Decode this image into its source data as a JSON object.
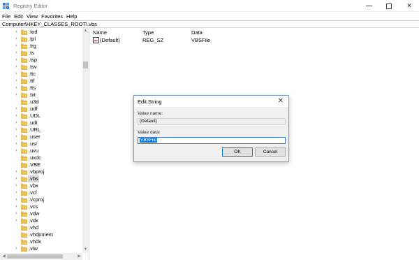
{
  "window": {
    "title": "Registry Editor",
    "controls": {
      "minimize": "min",
      "maximize": "max",
      "close": "✕"
    }
  },
  "menu": [
    "File",
    "Edit",
    "View",
    "Favorites",
    "Help"
  ],
  "address": "Computer\\HKEY_CLASSES_ROOT\\.vbs",
  "tree": {
    "items": [
      {
        "label": ".tod",
        "expandable": true
      },
      {
        "label": ".tpl",
        "expandable": true
      },
      {
        "label": ".trg",
        "expandable": true
      },
      {
        "label": ".ts",
        "expandable": true
      },
      {
        "label": ".tsp",
        "expandable": true
      },
      {
        "label": ".tsv",
        "expandable": true
      },
      {
        "label": ".ttc",
        "expandable": true
      },
      {
        "label": ".ttf",
        "expandable": true
      },
      {
        "label": ".tts",
        "expandable": true
      },
      {
        "label": ".txt",
        "expandable": true
      },
      {
        "label": ".u3d",
        "expandable": false
      },
      {
        "label": ".udf",
        "expandable": true
      },
      {
        "label": ".UDL",
        "expandable": true
      },
      {
        "label": ".udt",
        "expandable": true
      },
      {
        "label": ".URL",
        "expandable": true
      },
      {
        "label": ".user",
        "expandable": true
      },
      {
        "label": ".usr",
        "expandable": true
      },
      {
        "label": ".uvu",
        "expandable": true
      },
      {
        "label": ".uxdc",
        "expandable": false
      },
      {
        "label": ".VBE",
        "expandable": false
      },
      {
        "label": ".vbproj",
        "expandable": true
      },
      {
        "label": ".vbs",
        "expandable": true,
        "selected": true
      },
      {
        "label": ".vbx",
        "expandable": true
      },
      {
        "label": ".vcf",
        "expandable": true
      },
      {
        "label": ".vcproj",
        "expandable": true
      },
      {
        "label": ".vcs",
        "expandable": true
      },
      {
        "label": ".vdw",
        "expandable": true
      },
      {
        "label": ".vdx",
        "expandable": true
      },
      {
        "label": ".vhd",
        "expandable": false
      },
      {
        "label": ".vhdpmem",
        "expandable": false
      },
      {
        "label": ".vhdx",
        "expandable": false
      },
      {
        "label": ".viw",
        "expandable": true
      }
    ],
    "scroll_up": "▲",
    "scroll_down": "▼",
    "scroll_left": "◀",
    "scroll_right": "▶"
  },
  "list": {
    "columns": [
      "Name",
      "Type",
      "Data"
    ],
    "rows": [
      {
        "name": "(Default)",
        "type": "REG_SZ",
        "data": "VBSFile",
        "icon": "ab"
      }
    ]
  },
  "dialog": {
    "title": "Edit String",
    "close": "✕",
    "value_name_label": "Value name:",
    "value_name": "(Default)",
    "value_data_label": "Value data:",
    "value_data": "VBSFile",
    "ok": "OK",
    "cancel": "Cancel"
  },
  "colors": {
    "selection": "#0078d7",
    "folder": "#e8c05a",
    "folder_dark": "#d4a838"
  }
}
